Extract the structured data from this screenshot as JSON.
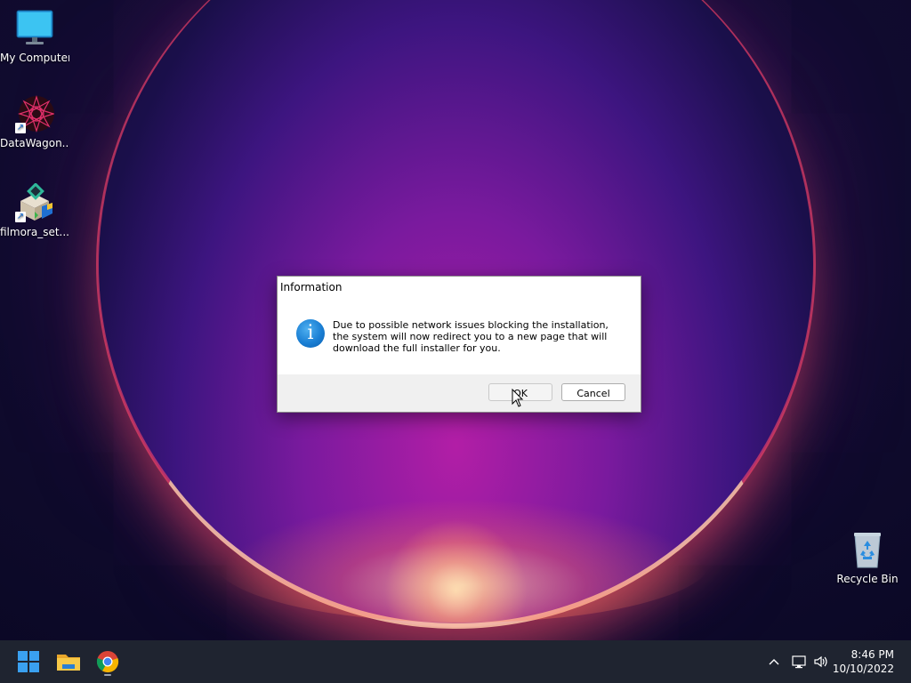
{
  "desktop": {
    "icons": [
      {
        "label": "My Computer",
        "icon": "monitor-icon"
      },
      {
        "label": "DataWagon...",
        "icon": "datawagon-icon"
      },
      {
        "label": "filmora_set...",
        "icon": "installer-icon"
      },
      {
        "label": "Recycle Bin",
        "icon": "recycle-bin-icon"
      }
    ]
  },
  "dialog": {
    "title": "Information",
    "message": "Due to possible network issues blocking the installation, the system will now redirect you to a new page that will download the full installer for you.",
    "icon": "info-icon",
    "ok_label": "OK",
    "cancel_label": "Cancel"
  },
  "taskbar": {
    "time": "8:46 PM",
    "date": "10/10/2022",
    "pinned": [
      "windows-start-icon",
      "file-explorer-icon",
      "chrome-icon"
    ],
    "tray": [
      "chevron-up-icon",
      "network-icon",
      "volume-icon"
    ]
  },
  "colors": {
    "taskbar_bg": "#1f2430",
    "accent_blue": "#1a7fd4",
    "dialog_footer": "#f0f0f0"
  }
}
